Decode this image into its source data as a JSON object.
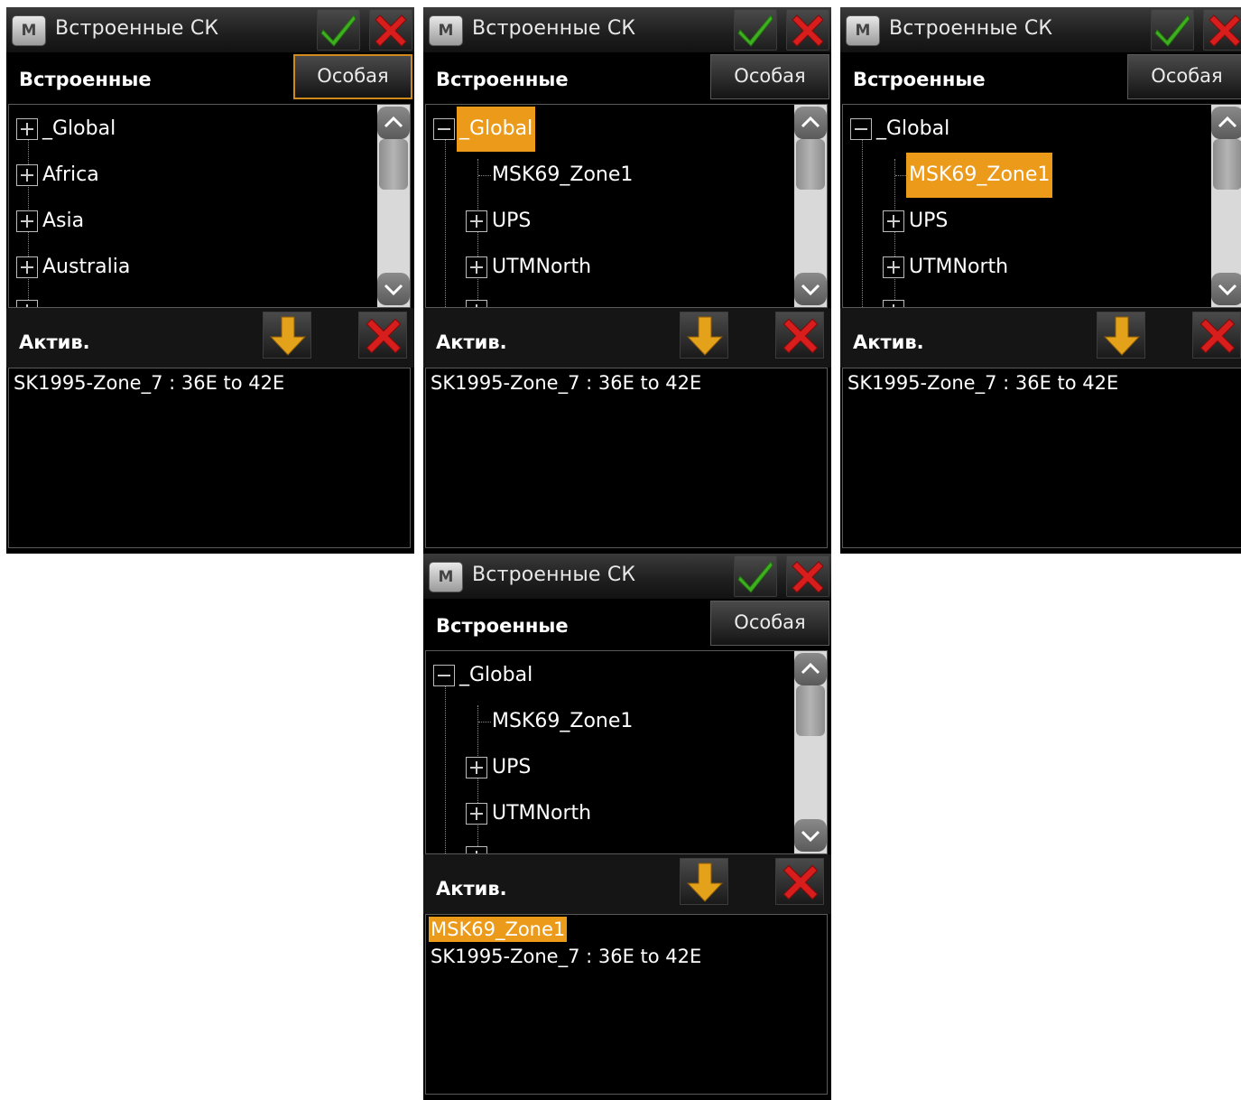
{
  "window": {
    "title": "Встроенные СК",
    "app_icon_letter": "M"
  },
  "sections": {
    "builtin_label": "Встроенные",
    "special_button": "Особая",
    "active_label": "Актив."
  },
  "colors": {
    "selection": "#eb9a1a",
    "ok_check": "#3fae1f",
    "cancel_x": "#d81d1d",
    "arrow": "#e3a219"
  },
  "icons": {
    "ok": "check-icon",
    "cancel": "close-icon",
    "move": "arrow-down-icon",
    "delete": "close-icon"
  },
  "panels": [
    {
      "tree": [
        {
          "label": "_Global",
          "expander": "plus",
          "selected": false
        },
        {
          "label": "Africa",
          "expander": "plus",
          "selected": false
        },
        {
          "label": "Asia",
          "expander": "plus",
          "selected": false
        },
        {
          "label": "Australia",
          "expander": "plus",
          "selected": false
        }
      ],
      "active_items": [
        {
          "label": "SK1995-Zone_7 : 36E to 42E",
          "selected": false
        }
      ],
      "special_active": true
    },
    {
      "tree": [
        {
          "label": "_Global",
          "expander": "minus",
          "selected": true
        },
        {
          "label": "MSK69_Zone1",
          "expander": "none",
          "selected": false
        },
        {
          "label": "UPS",
          "expander": "plus",
          "selected": false
        },
        {
          "label": "UTMNorth",
          "expander": "plus",
          "selected": false
        }
      ],
      "active_items": [
        {
          "label": "SK1995-Zone_7 : 36E to 42E",
          "selected": false
        }
      ],
      "special_active": false
    },
    {
      "tree": [
        {
          "label": "_Global",
          "expander": "minus",
          "selected": false
        },
        {
          "label": "MSK69_Zone1",
          "expander": "none",
          "selected": true
        },
        {
          "label": "UPS",
          "expander": "plus",
          "selected": false
        },
        {
          "label": "UTMNorth",
          "expander": "plus",
          "selected": false
        }
      ],
      "active_items": [
        {
          "label": "SK1995-Zone_7 : 36E to 42E",
          "selected": false
        }
      ],
      "special_active": false
    },
    {
      "tree": [
        {
          "label": "_Global",
          "expander": "minus",
          "selected": false
        },
        {
          "label": "MSK69_Zone1",
          "expander": "none",
          "selected": false
        },
        {
          "label": "UPS",
          "expander": "plus",
          "selected": false
        },
        {
          "label": "UTMNorth",
          "expander": "plus",
          "selected": false
        }
      ],
      "active_items": [
        {
          "label": "MSK69_Zone1",
          "selected": true
        },
        {
          "label": "SK1995-Zone_7 : 36E to 42E",
          "selected": false
        }
      ],
      "special_active": false
    }
  ]
}
